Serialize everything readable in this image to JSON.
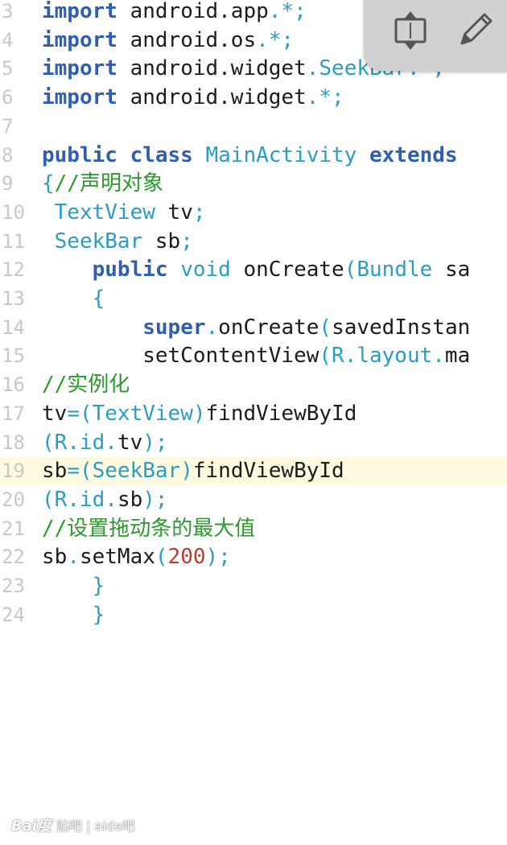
{
  "editor": {
    "lines": [
      {
        "num": "3",
        "tokens": [
          [
            "kw",
            "import"
          ],
          [
            "plain",
            " android.app"
          ],
          [
            "pun",
            ".*;"
          ]
        ]
      },
      {
        "num": "4",
        "tokens": [
          [
            "kw",
            "import"
          ],
          [
            "plain",
            " android.os"
          ],
          [
            "pun",
            ".*;"
          ]
        ]
      },
      {
        "num": "5",
        "tokens": [
          [
            "kw",
            "import"
          ],
          [
            "plain",
            " android.widget"
          ],
          [
            "pun",
            "."
          ],
          [
            "typ",
            "SeekBar"
          ],
          [
            "pun",
            ".*;"
          ]
        ]
      },
      {
        "num": "6",
        "tokens": [
          [
            "kw",
            "import"
          ],
          [
            "plain",
            " android.widget"
          ],
          [
            "pun",
            ".*;"
          ]
        ]
      },
      {
        "num": "7",
        "tokens": []
      },
      {
        "num": "8",
        "tokens": [
          [
            "kw",
            "public class"
          ],
          [
            "plain",
            " "
          ],
          [
            "typ",
            "MainActivity"
          ],
          [
            "plain",
            " "
          ],
          [
            "kw",
            "extends"
          ]
        ]
      },
      {
        "num": "9",
        "tokens": [
          [
            "pun",
            "{"
          ],
          [
            "cmt",
            "//声明对象"
          ]
        ]
      },
      {
        "num": "10",
        "tokens": [
          [
            "plain",
            " "
          ],
          [
            "typ",
            "TextView"
          ],
          [
            "plain",
            " tv"
          ],
          [
            "pun",
            ";"
          ]
        ]
      },
      {
        "num": "11",
        "tokens": [
          [
            "plain",
            " "
          ],
          [
            "typ",
            "SeekBar"
          ],
          [
            "plain",
            " sb"
          ],
          [
            "pun",
            ";"
          ]
        ]
      },
      {
        "num": "12",
        "tokens": [
          [
            "plain",
            "    "
          ],
          [
            "kw",
            "public"
          ],
          [
            "plain",
            " "
          ],
          [
            "typ",
            "void"
          ],
          [
            "plain",
            " onCreate"
          ],
          [
            "pun",
            "("
          ],
          [
            "typ",
            "Bundle"
          ],
          [
            "plain",
            " sa"
          ]
        ]
      },
      {
        "num": "13",
        "tokens": [
          [
            "plain",
            "    "
          ],
          [
            "pun",
            "{"
          ]
        ]
      },
      {
        "num": "14",
        "tokens": [
          [
            "plain",
            "        "
          ],
          [
            "kw",
            "super"
          ],
          [
            "pun",
            "."
          ],
          [
            "plain",
            "onCreate"
          ],
          [
            "pun",
            "("
          ],
          [
            "plain",
            "savedInstan"
          ]
        ]
      },
      {
        "num": "15",
        "tokens": [
          [
            "plain",
            "        setContentView"
          ],
          [
            "pun",
            "("
          ],
          [
            "typ",
            "R"
          ],
          [
            "pun",
            "."
          ],
          [
            "typ",
            "layout"
          ],
          [
            "pun",
            "."
          ],
          [
            "plain",
            "ma"
          ]
        ]
      },
      {
        "num": "16",
        "tokens": [
          [
            "cmt",
            "//实例化"
          ]
        ]
      },
      {
        "num": "17",
        "tokens": [
          [
            "plain",
            "tv"
          ],
          [
            "pun",
            "=("
          ],
          [
            "typ",
            "TextView"
          ],
          [
            "pun",
            ")"
          ],
          [
            "plain",
            "findViewById"
          ]
        ]
      },
      {
        "num": "18",
        "tokens": [
          [
            "pun",
            "("
          ],
          [
            "typ",
            "R"
          ],
          [
            "pun",
            "."
          ],
          [
            "typ",
            "id"
          ],
          [
            "pun",
            "."
          ],
          [
            "plain",
            "tv"
          ],
          [
            "pun",
            ");"
          ]
        ]
      },
      {
        "num": "19",
        "tokens": [
          [
            "plain",
            "sb"
          ],
          [
            "pun",
            "=("
          ],
          [
            "typ",
            "SeekBar"
          ],
          [
            "pun",
            ")"
          ],
          [
            "plain",
            "findViewById"
          ]
        ],
        "highlight": true
      },
      {
        "num": "20",
        "tokens": [
          [
            "pun",
            "("
          ],
          [
            "typ",
            "R"
          ],
          [
            "pun",
            "."
          ],
          [
            "typ",
            "id"
          ],
          [
            "pun",
            "."
          ],
          [
            "plain",
            "sb"
          ],
          [
            "pun",
            ");"
          ]
        ]
      },
      {
        "num": "21",
        "tokens": [
          [
            "cmt",
            "//设置拖动条的最大值"
          ]
        ]
      },
      {
        "num": "22",
        "tokens": [
          [
            "plain",
            "sb"
          ],
          [
            "pun",
            "."
          ],
          [
            "plain",
            "setMax"
          ],
          [
            "pun",
            "("
          ],
          [
            "num",
            "200"
          ],
          [
            "pun",
            ");"
          ]
        ]
      },
      {
        "num": "23",
        "tokens": [
          [
            "plain",
            "    "
          ],
          [
            "pun",
            "}"
          ]
        ]
      },
      {
        "num": "24",
        "tokens": [
          [
            "plain",
            "    "
          ],
          [
            "pun",
            "}"
          ]
        ]
      }
    ]
  },
  "toolbar": {
    "toggle_icon": "expand-collapse-icon",
    "edit_icon": "pencil-icon"
  },
  "watermark": {
    "logo": "Bai度",
    "text": "贴吧 | aide吧"
  }
}
